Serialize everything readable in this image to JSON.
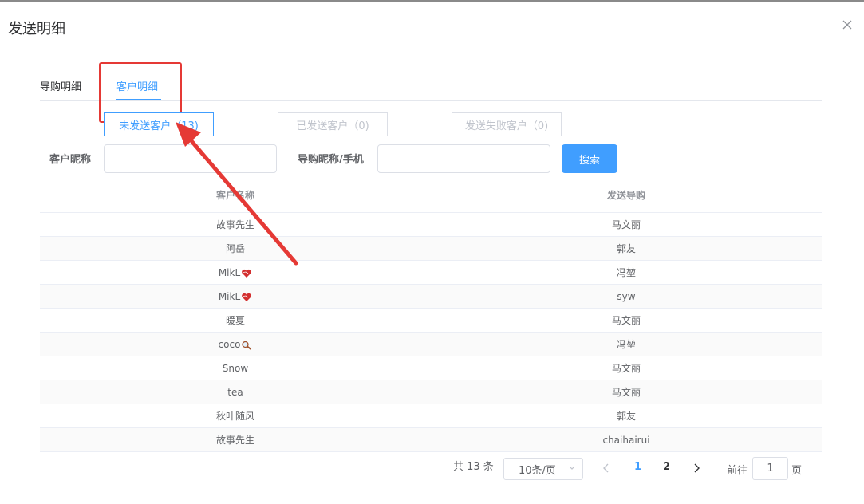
{
  "dialog": {
    "title": "发送明细"
  },
  "tabs": [
    {
      "label": "导购明细",
      "active": false
    },
    {
      "label": "客户明细",
      "active": true
    }
  ],
  "filters": [
    {
      "label": "未发送客户（13)",
      "active": true
    },
    {
      "label": "已发送客户（0)",
      "active": false
    },
    {
      "label": "发送失败客户（0)",
      "active": false
    }
  ],
  "form": {
    "customer_label": "客户昵称",
    "customer_value": "",
    "guide_label": "导购昵称/手机",
    "guide_value": "",
    "search_label": "搜索"
  },
  "table": {
    "headers": [
      "客户名称",
      "发送导购"
    ],
    "rows": [
      {
        "customer": "故事先生",
        "guide": "马文丽",
        "emoji": ""
      },
      {
        "customer": "阿岳",
        "guide": "郭友",
        "emoji": ""
      },
      {
        "customer": "MikL",
        "guide": "冯堃",
        "emoji": "heart"
      },
      {
        "customer": "MikL",
        "guide": "syw",
        "emoji": "heart"
      },
      {
        "customer": "暖夏",
        "guide": "马文丽",
        "emoji": ""
      },
      {
        "customer": "coco",
        "guide": "冯堃",
        "emoji": "magnifier"
      },
      {
        "customer": "Snow",
        "guide": "马文丽",
        "emoji": ""
      },
      {
        "customer": "tea",
        "guide": "马文丽",
        "emoji": ""
      },
      {
        "customer": "秋叶随风",
        "guide": "郭友",
        "emoji": ""
      },
      {
        "customer": "故事先生",
        "guide": "chaihairui",
        "emoji": ""
      }
    ]
  },
  "pagination": {
    "total_text": "共 13 条",
    "page_size": "10条/页",
    "pages": [
      "1",
      "2"
    ],
    "current_page": "1",
    "goto_prefix": "前往",
    "goto_value": "1",
    "goto_suffix": "页"
  },
  "colors": {
    "accent": "#409eff",
    "highlight": "#e53935"
  }
}
